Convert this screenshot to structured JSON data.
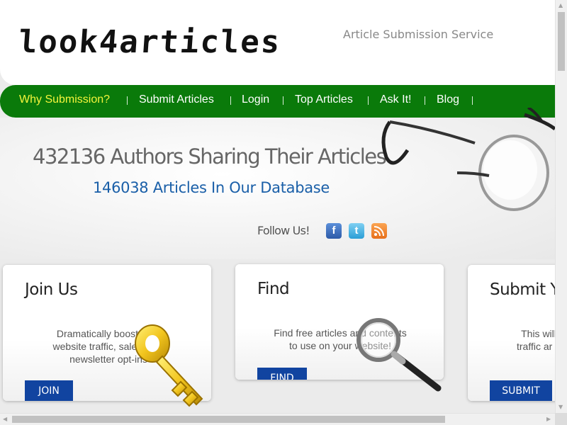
{
  "header": {
    "logo_text": "look4articles",
    "tagline": "Article Submission Service"
  },
  "nav": {
    "items": [
      {
        "label": "Why Submission?",
        "active": true
      },
      {
        "label": "Submit Articles",
        "active": false
      },
      {
        "label": "Login",
        "active": false
      },
      {
        "label": "Top Articles",
        "active": false
      },
      {
        "label": "Ask It!",
        "active": false
      },
      {
        "label": "Blog",
        "active": false
      }
    ]
  },
  "hero": {
    "authors_line": "432136 Authors Sharing Their Articles",
    "articles_line": "146038 Articles In Our Database",
    "follow_label": "Follow Us!",
    "social": [
      {
        "name": "facebook-icon",
        "glyph": "f"
      },
      {
        "name": "twitter-icon",
        "glyph": "t"
      },
      {
        "name": "rss-icon",
        "glyph": "≋"
      }
    ]
  },
  "cards": [
    {
      "title": "Join Us",
      "text": "Dramatically boost your website traffic, sales, and newsletter opt-ins",
      "button": "JOIN"
    },
    {
      "title": "Find",
      "text": "Find free articles and contents to use on your website!",
      "button": "FIND"
    },
    {
      "title": "Submit Y",
      "text": "This will traffic ar e",
      "button": "SUBMIT"
    }
  ],
  "colors": {
    "nav_green": "#0a7a0a",
    "active_nav": "#f5f53c",
    "button_blue": "#1144a0",
    "articles_blue": "#1a5fa8"
  }
}
